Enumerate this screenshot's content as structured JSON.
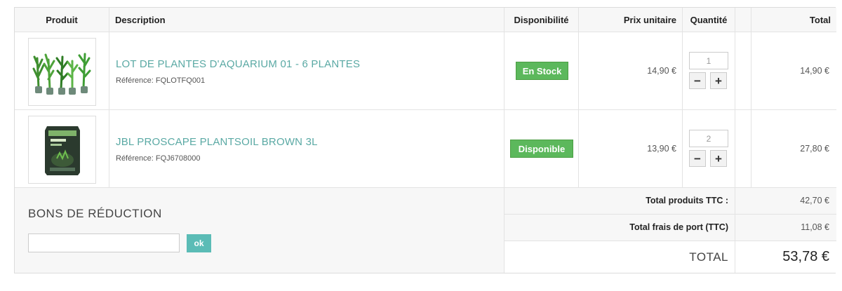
{
  "headers": {
    "product": "Produit",
    "description": "Description",
    "availability": "Disponibilité",
    "unit_price": "Prix unitaire",
    "quantity": "Quantité",
    "total": "Total"
  },
  "items": [
    {
      "name": "LOT DE PLANTES D'AQUARIUM 01 - 6 PLANTES",
      "reference_label": "Référence:",
      "reference": "FQLOTFQ001",
      "availability": "En Stock",
      "unit_price": "14,90 €",
      "quantity": "1",
      "total": "14,90 €",
      "image_icon": "aquarium-plants-icon"
    },
    {
      "name": "JBL PROSCAPE PLANTSOIL BROWN 3L",
      "reference_label": "Référence:",
      "reference": "FQJ6708000",
      "availability": "Disponible",
      "unit_price": "13,90 €",
      "quantity": "2",
      "total": "27,80 €",
      "image_icon": "soil-bag-icon"
    }
  ],
  "qty_controls": {
    "minus": "−",
    "plus": "+"
  },
  "summary": {
    "products_label": "Total produits TTC :",
    "products_value": "42,70 €",
    "shipping_label": "Total frais de port (TTC)",
    "shipping_value": "11,08 €",
    "total_label": "TOTAL",
    "total_value": "53,78 €"
  },
  "voucher": {
    "title": "BONS DE RÉDUCTION",
    "input_value": "",
    "button": "ok"
  },
  "colors": {
    "link": "#5aa9a4",
    "stock_badge": "#5cb85c",
    "ok_button": "#5bbcb6"
  }
}
